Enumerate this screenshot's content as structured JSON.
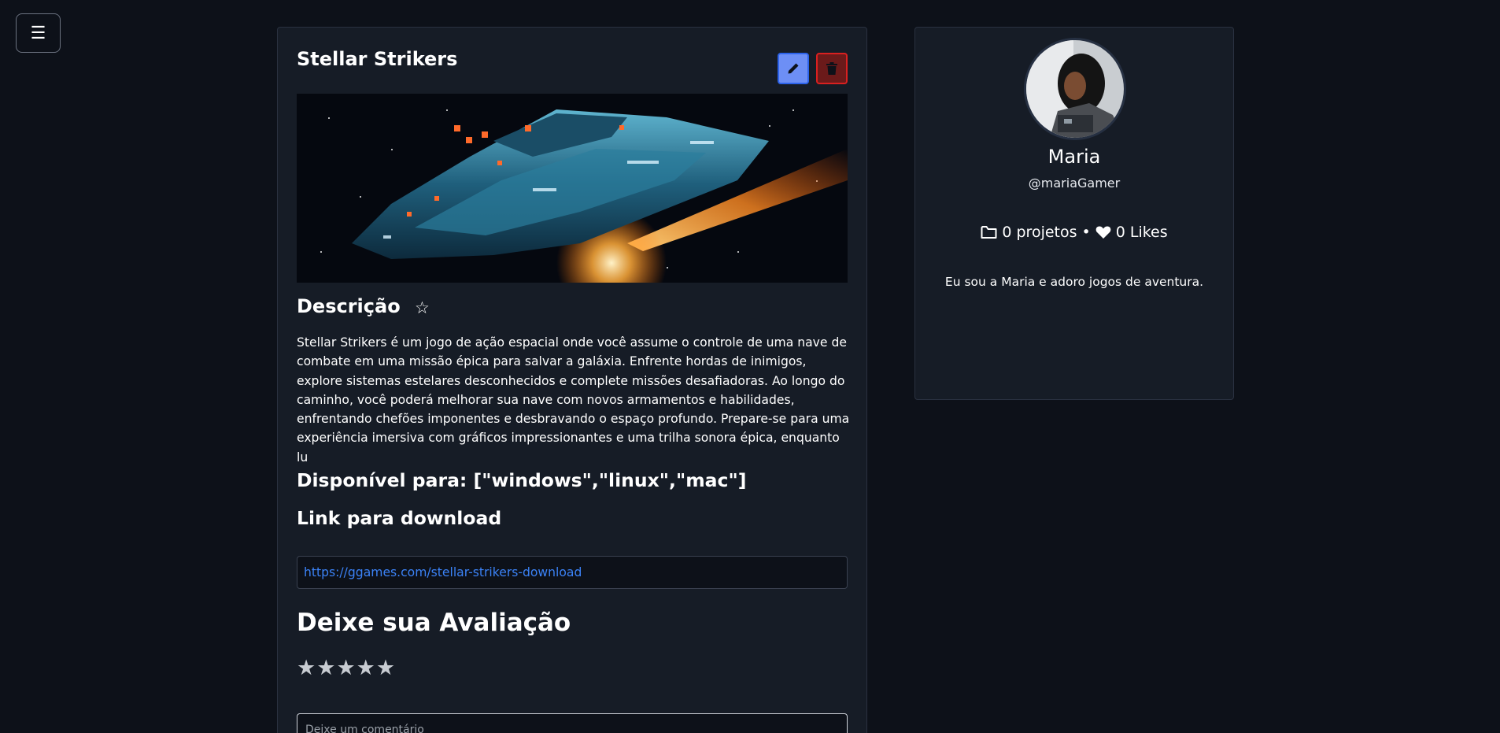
{
  "menu": {
    "label": "☰"
  },
  "project": {
    "title": "Stellar Strikers",
    "description_heading": "Descrição",
    "description": "Stellar Strikers é um jogo de ação espacial onde você assume o controle de uma nave de combate em uma missão épica para salvar a galáxia. Enfrente hordas de inimigos, explore sistemas estelares desconhecidos e complete missões desafiadoras. Ao longo do caminho, você poderá melhorar sua nave com novos armamentos e habilidades, enfrentando chefões imponentes e desbravando o espaço profundo. Prepare-se para uma experiência imersiva com gráficos impressionantes e uma trilha sonora épica, enquanto lu",
    "platforms": "Disponível para: [\"windows\",\"linux\",\"mac\"]",
    "download_heading": "Link para download",
    "download_url": "https://ggames.com/stellar-strikers-download"
  },
  "review": {
    "heading": "Deixe sua Avaliação",
    "stars": [
      "★",
      "★",
      "★",
      "★",
      "★"
    ],
    "comment_placeholder": "Deixe um comentário"
  },
  "profile": {
    "name": "Maria",
    "username": "@mariaGamer",
    "projects": "0 projetos",
    "separator": "•",
    "likes": "0 Likes",
    "bio": "Eu sou a Maria e adoro jogos de aventura."
  },
  "colors": {
    "background": "#0d1119",
    "card": "#161c26",
    "edit_button": "#6d8ff5",
    "delete_button_border": "#d92020",
    "link": "#3b82f6"
  }
}
